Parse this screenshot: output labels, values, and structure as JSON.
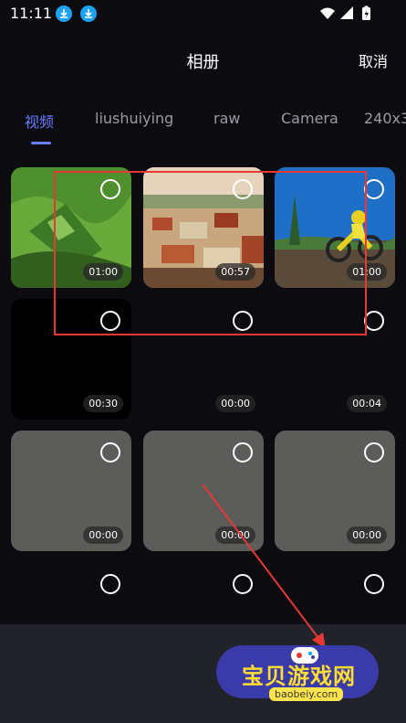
{
  "status_bar": {
    "time": "11:11"
  },
  "header": {
    "title": "相册",
    "cancel_label": "取消"
  },
  "tabs": [
    {
      "label": "视频",
      "active": true
    },
    {
      "label": "liushuiying",
      "active": false
    },
    {
      "label": "raw",
      "active": false
    },
    {
      "label": "Camera",
      "active": false
    },
    {
      "label": "240x3",
      "active": false
    }
  ],
  "videos": [
    {
      "duration": "01:00",
      "thumb": "green-landscape"
    },
    {
      "duration": "00:57",
      "thumb": "town-aerial"
    },
    {
      "duration": "01:00",
      "thumb": "motocross"
    },
    {
      "duration": "00:30",
      "thumb": "black"
    },
    {
      "duration": "00:00",
      "thumb": "empty"
    },
    {
      "duration": "00:04",
      "thumb": "empty"
    },
    {
      "duration": "00:00",
      "thumb": "grey-noise"
    },
    {
      "duration": "00:00",
      "thumb": "grey-noise"
    },
    {
      "duration": "00:00",
      "thumb": "grey-noise"
    },
    {
      "duration": "",
      "thumb": "empty"
    },
    {
      "duration": "",
      "thumb": "empty"
    },
    {
      "duration": "",
      "thumb": "empty"
    }
  ],
  "watermark": {
    "text": "宝贝游戏网",
    "sub": "baobeiy.com"
  },
  "colors": {
    "accent": "#6a7cff",
    "annotation": "#e53935",
    "background": "#0c0c10"
  }
}
